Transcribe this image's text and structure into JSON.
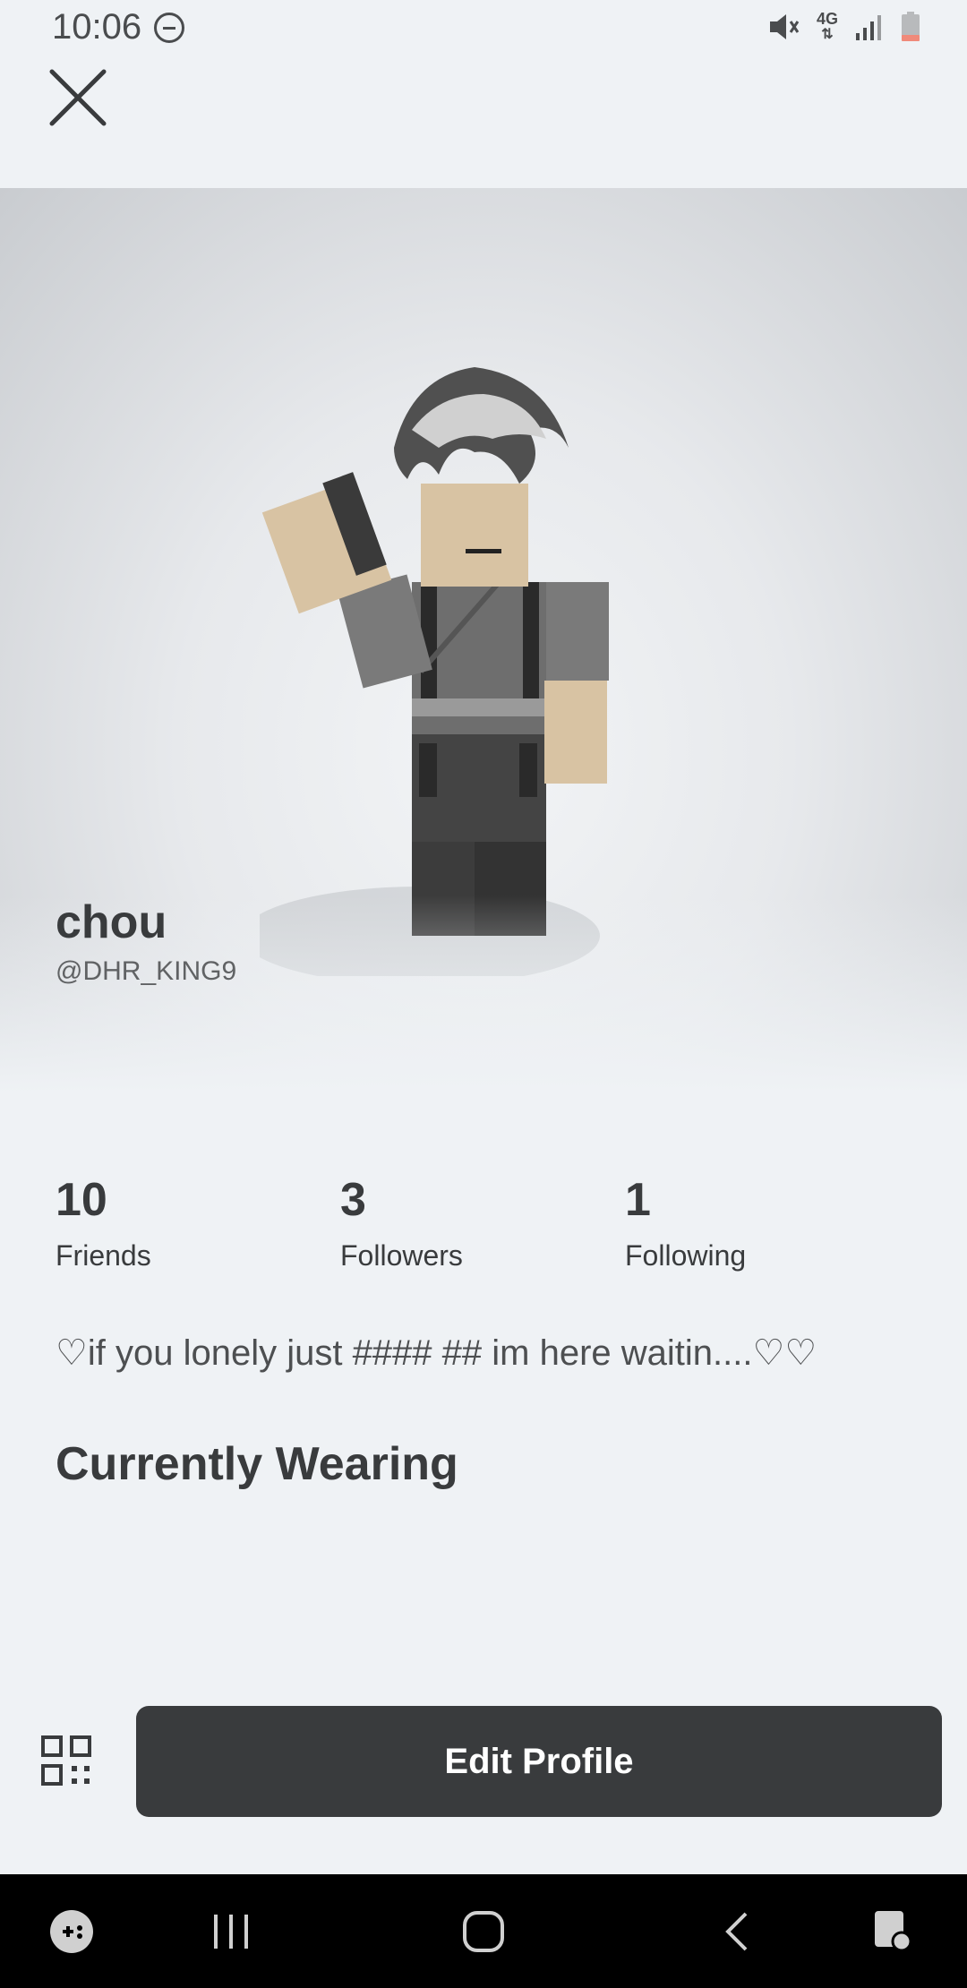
{
  "status_bar": {
    "time": "10:06",
    "network": "4G"
  },
  "profile": {
    "display_name": "chou",
    "username": "@DHR_KING9",
    "bio": "♡if you lonely just #### ## im here waitin....♡♡"
  },
  "stats": [
    {
      "value": "10",
      "label": "Friends"
    },
    {
      "value": "3",
      "label": "Followers"
    },
    {
      "value": "1",
      "label": "Following"
    }
  ],
  "sections": {
    "currently_wearing": "Currently Wearing"
  },
  "actions": {
    "edit_profile": "Edit Profile"
  },
  "icons": [
    "close-icon",
    "qr-code-icon",
    "mute-icon",
    "signal-icon",
    "battery-icon",
    "game-launcher-icon",
    "recents-icon",
    "home-icon",
    "back-icon",
    "screen-lock-icon"
  ],
  "colors": {
    "background": "#eff2f5",
    "primary_text": "#393b3d",
    "button_bg": "#393b3d",
    "button_text": "#ffffff",
    "battery_low": "#f08a7a"
  }
}
